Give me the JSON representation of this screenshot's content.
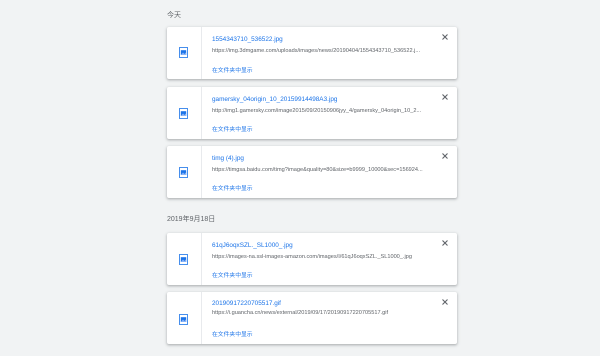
{
  "groups": [
    {
      "header": "今天",
      "items": [
        {
          "name": "1554343710_536522.jpg",
          "url": "https://img.3dmgame.com/uploads/images/news/20190404/1554343710_536522.j...",
          "action": "在文件夹中显示"
        },
        {
          "name": "gamersky_04origin_10_20159914498A3.jpg",
          "url": "http://img1.gamersky.com/image2015/09/20150906jyy_4/gamersky_04origin_10_2...",
          "action": "在文件夹中显示"
        },
        {
          "name": "timg (4).jpg",
          "url": "https://timgsa.baidu.com/timg?image&quality=80&size=b9999_10000&sec=156924...",
          "action": "在文件夹中显示"
        }
      ]
    },
    {
      "header": "2019年9月18日",
      "items": [
        {
          "name": "61qJ6oqxSZL._SL1000_.jpg",
          "url": "https://images-na.ssl-images-amazon.com/images/I/61qJ6oqxSZL._SL1000_.jpg",
          "action": "在文件夹中显示"
        },
        {
          "name": "20190917220705517.gif",
          "url": "https://i.guancha.cn/news/external/2019/09/17/20190917220705517.gif",
          "action": "在文件夹中显示"
        }
      ]
    }
  ],
  "icons": {
    "file": "image-file-icon",
    "close": "close-icon"
  },
  "colors": {
    "link": "#1a73e8",
    "background": "#f1f3f4"
  }
}
